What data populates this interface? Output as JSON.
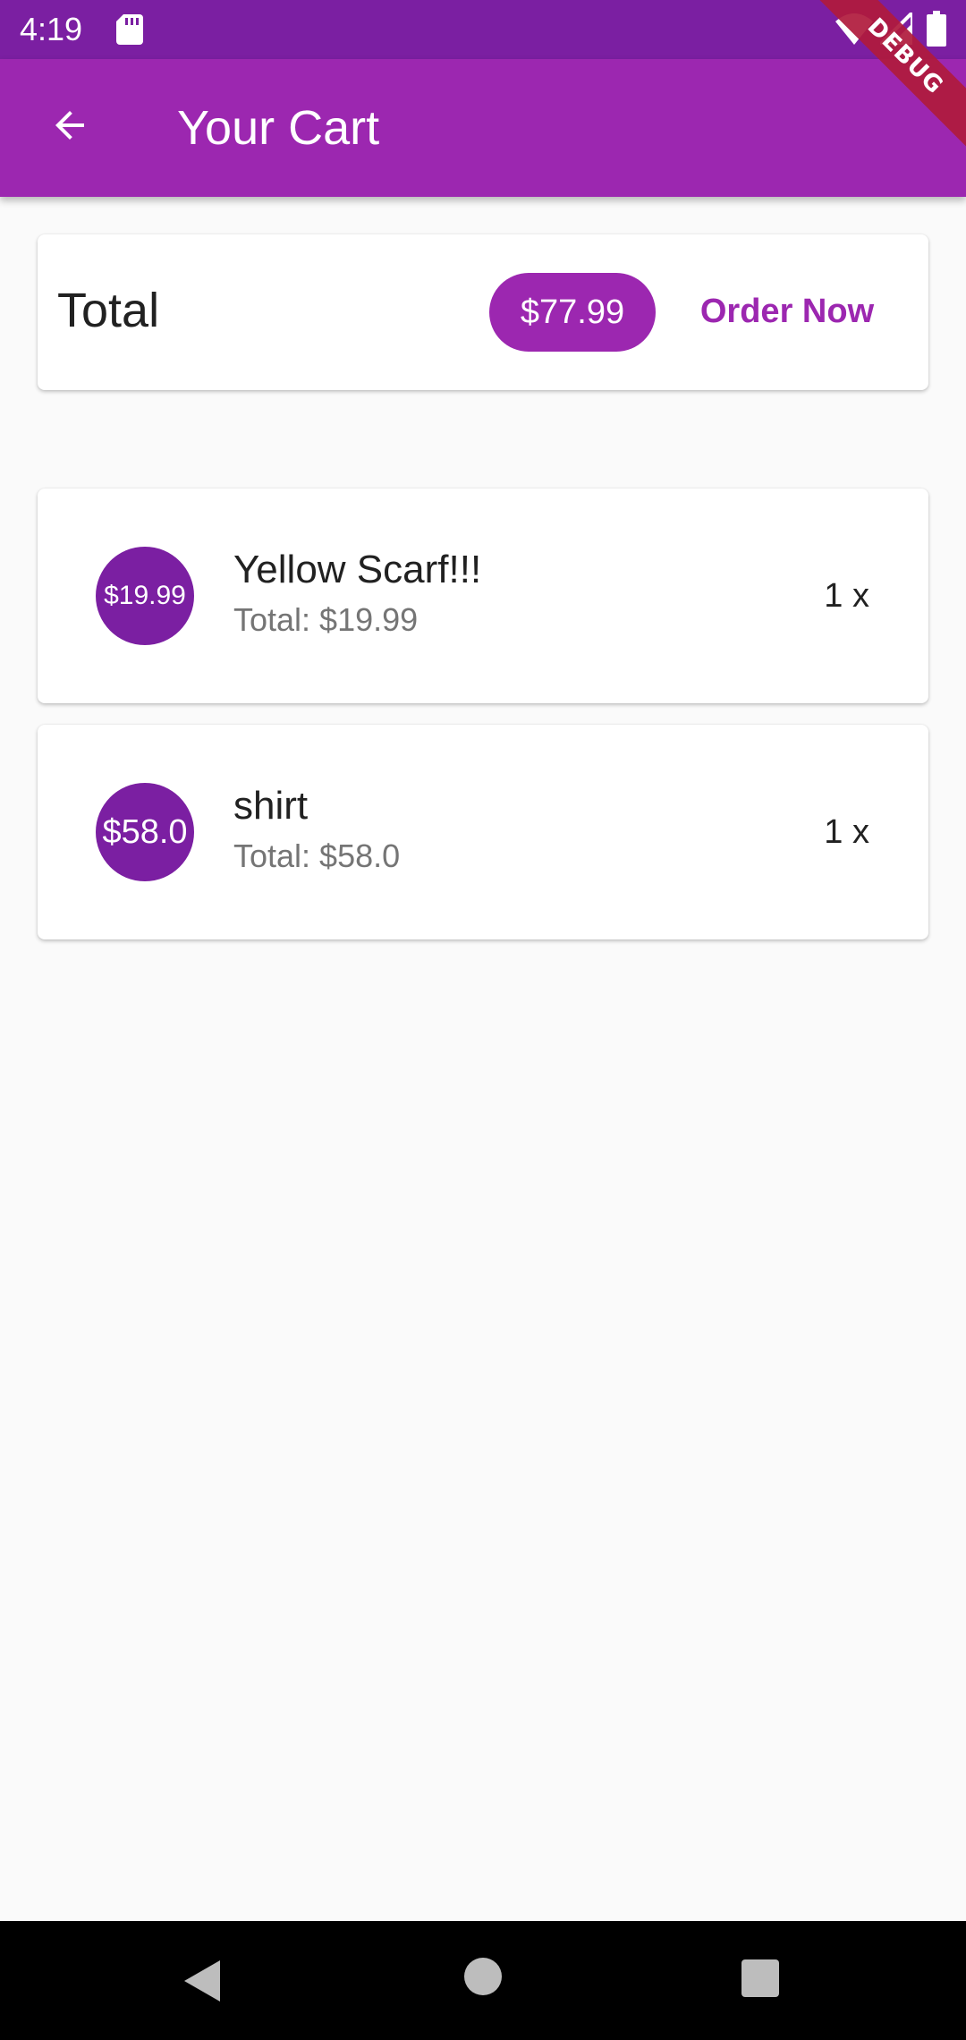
{
  "status_bar": {
    "time": "4:19",
    "icons": [
      "sd-card-icon",
      "wifi-icon",
      "signal-icon",
      "battery-icon"
    ]
  },
  "app_bar": {
    "title": "Your Cart",
    "back_icon": "arrow-back-icon"
  },
  "debug_banner": "DEBUG",
  "summary": {
    "label": "Total",
    "amount": "$77.99",
    "order_button": "Order Now"
  },
  "cart_items": [
    {
      "avatar_text": "$19.99",
      "title": "Yellow Scarf!!!",
      "subtitle": "Total: $19.99",
      "quantity": "1 x"
    },
    {
      "avatar_text": "$58.0",
      "title": "shirt",
      "subtitle": "Total: $58.0",
      "quantity": "1 x"
    }
  ],
  "nav_bar": {
    "buttons": [
      "back-triangle-icon",
      "home-circle-icon",
      "recents-square-icon"
    ]
  },
  "colors": {
    "status_bar": "#7b1fa2",
    "app_bar": "#9c27b0",
    "accent": "#9c27b0",
    "avatar": "#7b1fa2",
    "background": "#fafafa"
  }
}
